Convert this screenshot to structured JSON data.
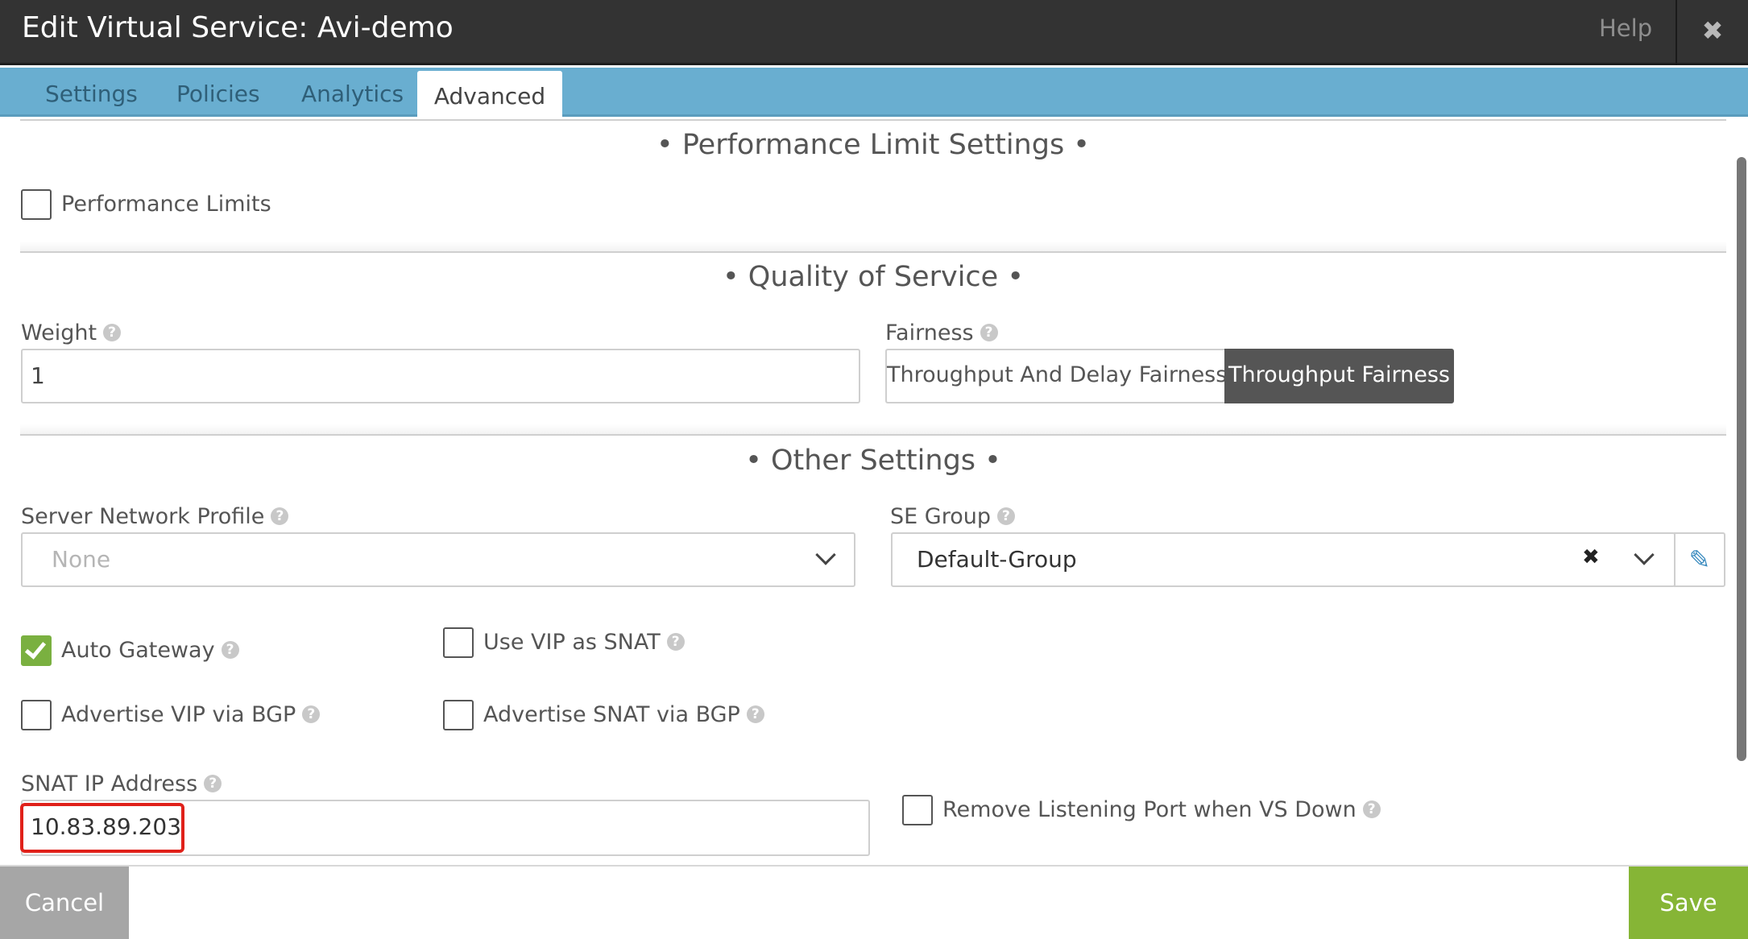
{
  "window": {
    "title": "Edit Virtual Service: Avi-demo",
    "help_label": "Help",
    "close_glyph": "✖"
  },
  "tabs": [
    {
      "label": "Settings",
      "active": false
    },
    {
      "label": "Policies",
      "active": false
    },
    {
      "label": "Analytics",
      "active": false
    },
    {
      "label": "Advanced",
      "active": true
    }
  ],
  "sections": {
    "performance": {
      "title": "• Performance Limit Settings •",
      "performance_limits": {
        "label": "Performance Limits",
        "checked": false
      }
    },
    "qos": {
      "title": "• Quality of Service •",
      "weight": {
        "label": "Weight",
        "value": "1"
      },
      "fairness": {
        "label": "Fairness",
        "options": [
          "Throughput And Delay Fairness",
          "Throughput Fairness"
        ],
        "selected": "Throughput Fairness"
      }
    },
    "other": {
      "title": "• Other Settings •",
      "server_network_profile": {
        "label": "Server Network Profile",
        "placeholder": "None"
      },
      "se_group": {
        "label": "SE Group",
        "value": "Default-Group",
        "clear_glyph": "✖",
        "edit_glyph": "✎"
      },
      "auto_gateway": {
        "label": "Auto Gateway",
        "checked": true
      },
      "use_vip_as_snat": {
        "label": "Use VIP as SNAT",
        "checked": false
      },
      "advertise_vip_bgp": {
        "label": "Advertise VIP via BGP",
        "checked": false
      },
      "advertise_snat_bgp": {
        "label": "Advertise SNAT via BGP",
        "checked": false
      },
      "snat_ip": {
        "label": "SNAT IP Address",
        "value": "10.83.89.203"
      },
      "remove_listening_port": {
        "label": "Remove Listening Port when VS Down",
        "checked": false
      }
    }
  },
  "help_glyph": "?",
  "footer": {
    "cancel_label": "Cancel",
    "save_label": "Save"
  },
  "colors": {
    "titlebar": "#333333",
    "tabbar": "#69aed0",
    "checked_green": "#7ab040",
    "save_green": "#86b536",
    "cancel_gray": "#a6a6a6",
    "highlight_red": "#e0211a",
    "segment_selected": "#555555"
  }
}
